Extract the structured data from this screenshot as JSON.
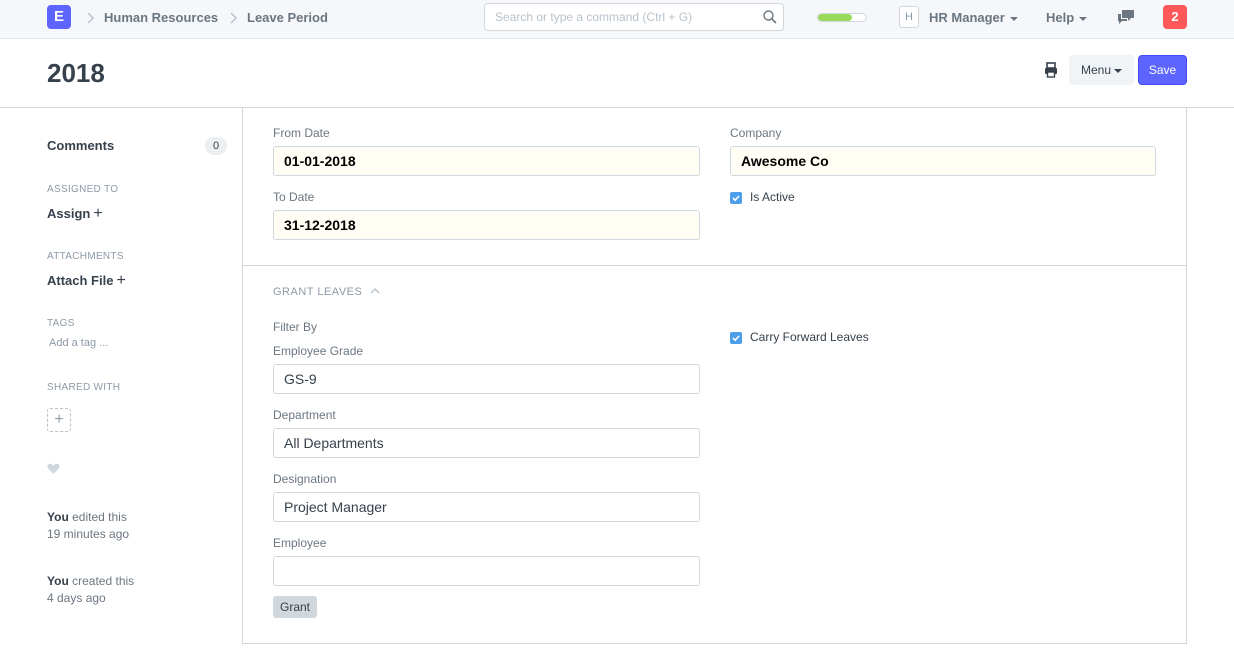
{
  "navbar": {
    "logo_letter": "E",
    "breadcrumbs": [
      "Human Resources",
      "Leave Period"
    ],
    "search_placeholder": "Search or type a command (Ctrl + G)",
    "progress_fraction": 0.7,
    "progress_color": "#98d85b",
    "avatar_letter": "H",
    "user_menu": "HR Manager",
    "help_menu": "Help",
    "notification_count": "2"
  },
  "page": {
    "title": "2018",
    "menu_label": "Menu",
    "save_label": "Save"
  },
  "sidebar": {
    "comments_label": "Comments",
    "comments_count": "0",
    "assigned_to_label": "ASSIGNED TO",
    "assign_label": "Assign",
    "attachments_label": "ATTACHMENTS",
    "attach_label": "Attach File",
    "tags_label": "TAGS",
    "add_tag_label": "Add a tag ...",
    "shared_with_label": "SHARED WITH",
    "timeline": [
      {
        "actor": "You",
        "action": "edited this",
        "when": "19 minutes ago"
      },
      {
        "actor": "You",
        "action": "created this",
        "when": "4 days ago"
      }
    ]
  },
  "form": {
    "from_date_label": "From Date",
    "from_date_value": "01-01-2018",
    "to_date_label": "To Date",
    "to_date_value": "31-12-2018",
    "company_label": "Company",
    "company_value": "Awesome Co",
    "is_active_label": "Is Active",
    "is_active_checked": true,
    "grant_section_title": "GRANT LEAVES",
    "filter_by_label": "Filter By",
    "employee_grade_label": "Employee Grade",
    "employee_grade_value": "GS-9",
    "department_label": "Department",
    "department_value": "All Departments",
    "designation_label": "Designation",
    "designation_value": "Project Manager",
    "employee_label": "Employee",
    "employee_value": "",
    "carry_forward_label": "Carry Forward Leaves",
    "carry_forward_checked": true,
    "grant_button_label": "Grant"
  },
  "colors": {
    "primary": "#5e64ff",
    "notification": "#ff5858",
    "checkbox": "#4d9eeb"
  }
}
